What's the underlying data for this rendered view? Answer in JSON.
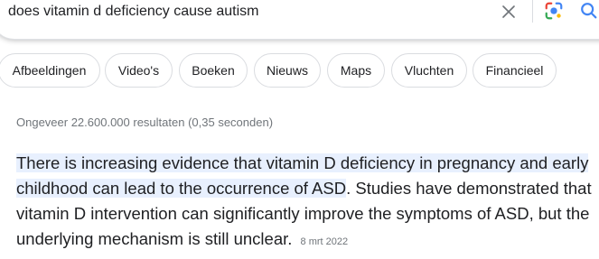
{
  "search": {
    "query": "does vitamin d deficiency cause autism"
  },
  "icons": {
    "clear": "close-icon",
    "lens": "google-lens-icon",
    "search": "search-icon"
  },
  "colors": {
    "lens_blue": "#4285f4",
    "lens_red": "#ea4335",
    "lens_yellow": "#fbbc04",
    "lens_green": "#34a853",
    "highlight": "#e8f0fe"
  },
  "chips": [
    {
      "label": "Afbeeldingen"
    },
    {
      "label": "Video's"
    },
    {
      "label": "Boeken"
    },
    {
      "label": "Nieuws"
    },
    {
      "label": "Maps"
    },
    {
      "label": "Vluchten"
    },
    {
      "label": "Financieel"
    }
  ],
  "result_stats": "Ongeveer 22.600.000 resultaten (0,35 seconden)",
  "snippet": {
    "highlighted": "There is increasing evidence that vitamin D deficiency in pregnancy and early childhood can lead to the occurrence of ASD",
    "rest": ". Studies have demonstrated that vitamin D intervention can significantly improve the symptoms of ASD, but the underlying mechanism is still unclear.",
    "date": "8 mrt 2022"
  }
}
